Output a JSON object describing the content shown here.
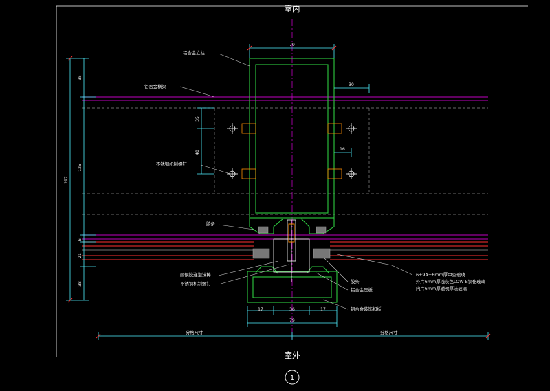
{
  "titles": {
    "indoor": "室内",
    "outdoor": "室外",
    "detail_number": "1"
  },
  "labels": {
    "mullion": "铝合金立柱",
    "transom": "铝合金横梁",
    "ss_screw_upper": "不锈钢机制螺钉",
    "rubber_strip_left": "胶条",
    "sealant": "耐候胶连泡沫棒",
    "ss_screw_lower": "不锈钢机制螺钉",
    "rubber_strip_right": "胶条",
    "pressure_plate": "铝合金压板",
    "cover_plate": "铝合金装饰扣板",
    "glass_line1": "6+9A+6mm厚中空玻璃",
    "glass_line2": "外片6mm厚浅灰色LOW-E钢化玻璃",
    "glass_line3": "内片6mm厚透明厚法玻璃",
    "grid_left": "分格尺寸",
    "grid_right": "分格尺寸"
  },
  "dimensions": {
    "top_width": "79",
    "side_30": "30",
    "side_16": "16",
    "v_35": "35",
    "v_297": "297",
    "v_125": "125",
    "v_6": "6",
    "v_21": "21",
    "v_38": "38",
    "h_35": "35",
    "h_40": "40",
    "b_17_left": "17",
    "b_36": "36",
    "b_17_right": "17",
    "b_79": "79"
  },
  "colors": {
    "background": "#000000",
    "profile": "#2ecc40",
    "dimension": "#4ff0ff",
    "transom": "#c000c0",
    "glass": "#ff3030",
    "text": "#ffffff"
  }
}
